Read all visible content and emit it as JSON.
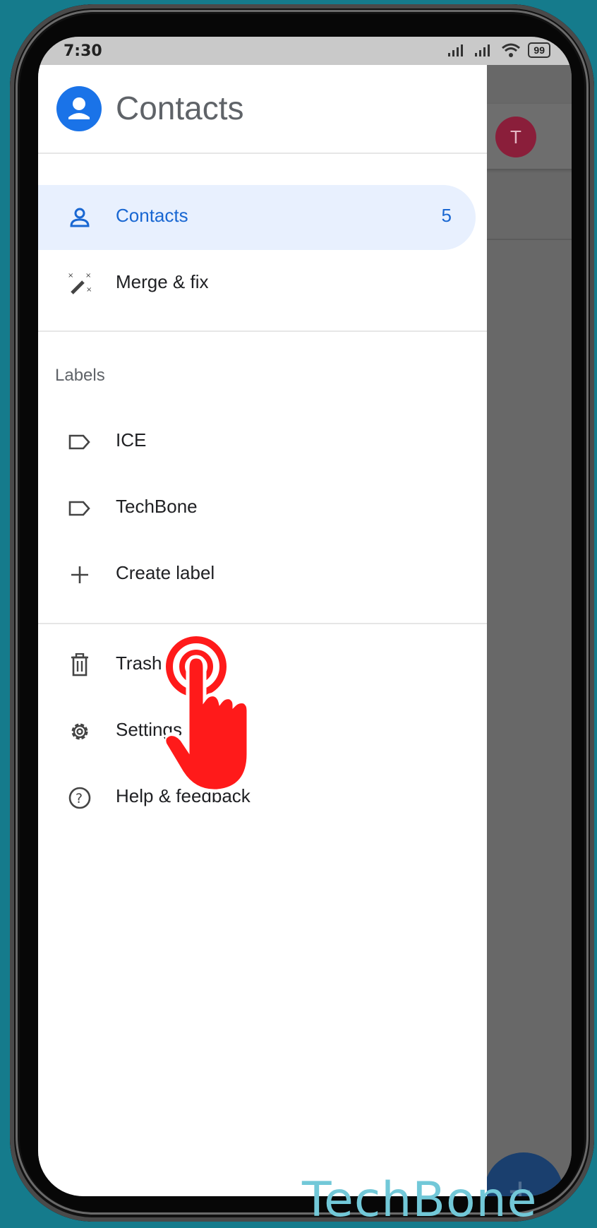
{
  "status_bar": {
    "time": "7:30",
    "battery": "99"
  },
  "header": {
    "title": "Contacts"
  },
  "background_app": {
    "avatar_letter": "T"
  },
  "nav": {
    "contacts": {
      "label": "Contacts",
      "count": "5"
    },
    "merge_fix": {
      "label": "Merge & fix"
    }
  },
  "labels_section": {
    "title": "Labels",
    "items": [
      {
        "label": "ICE"
      },
      {
        "label": "TechBone"
      }
    ],
    "create_label": "Create label"
  },
  "footer_items": {
    "trash": "Trash",
    "settings": "Settings",
    "help": "Help & feedback"
  },
  "watermark": "TechBone",
  "colors": {
    "accent": "#1967d2",
    "selected_bg": "#e8f0fe",
    "tap_indicator": "#ff1a1a",
    "background": "#157b8c"
  },
  "icons": [
    "person-icon",
    "magic-wand-icon",
    "label-icon",
    "plus-icon",
    "trash-icon",
    "gear-icon",
    "help-circle-icon",
    "tap-hand-icon"
  ]
}
